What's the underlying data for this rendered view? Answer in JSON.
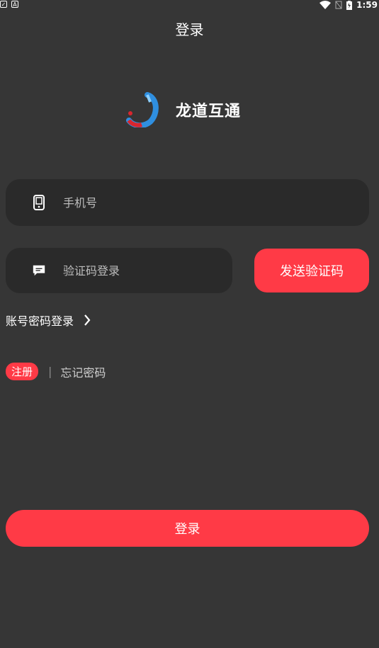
{
  "status_bar": {
    "time": "1:59",
    "left_icons": [
      "checkbox-icon",
      "a-icon"
    ],
    "right_icons": [
      "wifi-icon",
      "no-signal-icon",
      "battery-icon"
    ]
  },
  "header": {
    "title": "登录"
  },
  "brand": {
    "name": "龙道互通",
    "logo": "app-logo-icon"
  },
  "form": {
    "phone_placeholder": "手机号",
    "code_placeholder": "验证码登录",
    "send_code_label": "发送验证码",
    "password_login_label": "账号密码登录",
    "register_label": "注册",
    "separator": "|",
    "forgot_label": "忘记密码",
    "login_label": "登录"
  },
  "colors": {
    "background": "#363636",
    "field": "#2a2a2a",
    "accent": "#ff3a46"
  }
}
